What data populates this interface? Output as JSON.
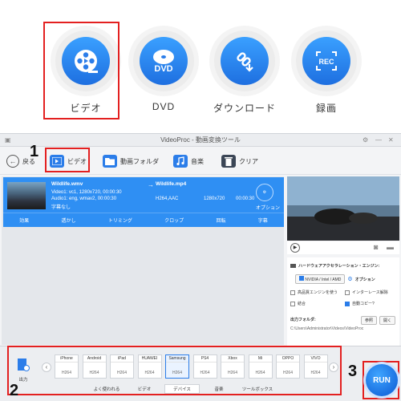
{
  "top_buttons": [
    {
      "label": "ビデオ",
      "icon": "video-reel-icon"
    },
    {
      "label": "DVD",
      "icon": "dvd-icon"
    },
    {
      "label": "ダウンロード",
      "icon": "download-link-icon"
    },
    {
      "label": "録画",
      "icon": "rec-icon"
    }
  ],
  "window": {
    "title": "VideoProc - 動画変換ツール"
  },
  "toolbar": {
    "back_label": "戻る",
    "video_label": "ビデオ",
    "folder_label": "動画フォルダ",
    "music_label": "音楽",
    "clear_label": "クリア"
  },
  "task": {
    "source_name": "Wildlife.wmv",
    "video_info": "Video1: vc1, 1280x720, 00:00:30",
    "audio_info": "Audio1: eng, wmav2, 00:00:30",
    "subtitle_info": "字幕なし",
    "output_name": "Wildlife.mp4",
    "output_codec": "H264,AAC",
    "output_res": "1280x720",
    "output_duration": "00:00:30",
    "codec_option": "オプション",
    "edit_buttons": [
      "効果",
      "透かし",
      "トリミング",
      "クロップ",
      "回転",
      "字幕"
    ]
  },
  "settings": {
    "hw_accel_label": "ハードウェアアクセラレーション・エンジン:",
    "hw_vendor": "NVIDIA / Intel / AMD",
    "option_label": "オプション",
    "hq_engine": "高品質エンジンを使う",
    "deinterlace": "インターレース解除",
    "merge": "結合",
    "auto_copy": "自動コピー?",
    "output_folder_label": "出力フォルダ:",
    "browse_label": "参照",
    "open_label": "開く",
    "output_path": "C:\\Users\\Administrator\\Videos\\VideoProc"
  },
  "formats": {
    "output_label": "出力",
    "items": [
      {
        "brand": "iPhone",
        "codec": "H264"
      },
      {
        "brand": "Android",
        "codec": "H264"
      },
      {
        "brand": "iPad",
        "codec": "H264"
      },
      {
        "brand": "HUAWEI",
        "codec": "H264"
      },
      {
        "brand": "Samsung",
        "codec": "H264"
      },
      {
        "brand": "PS4",
        "codec": "H264"
      },
      {
        "brand": "Xbox",
        "codec": "H264"
      },
      {
        "brand": "Mi",
        "codec": "H264"
      },
      {
        "brand": "OPPO",
        "codec": "H264"
      },
      {
        "brand": "VIVO",
        "codec": "H264"
      }
    ],
    "tabs": [
      "よく使われる",
      "ビデオ",
      "デバイス",
      "音楽",
      "ツールボックス"
    ],
    "active_tab": "デバイス"
  },
  "run_label": "RUN",
  "annotations": {
    "n1": "1",
    "n2": "2",
    "n3": "3"
  },
  "colors": {
    "accent": "#2b7de9",
    "highlight": "#e32020"
  }
}
